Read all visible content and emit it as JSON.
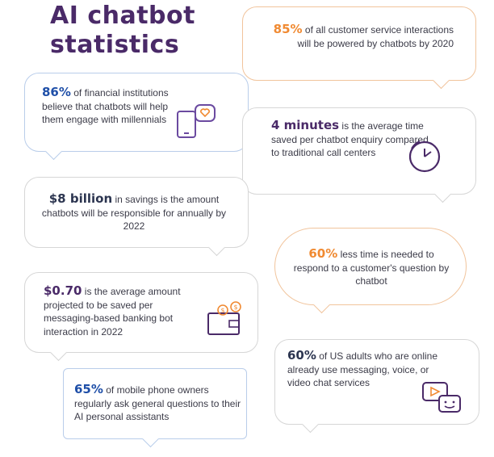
{
  "title": "AI chatbot statistics",
  "colors": {
    "title": "#4a2a68",
    "orange": "#f08a32",
    "blue": "#1f4fa8",
    "purple": "#4a2a68",
    "dark": "#2c3550"
  },
  "stats": [
    {
      "highlight": "85%",
      "text": "of all customer service interactions will be powered by chatbots by 2020"
    },
    {
      "highlight": "86%",
      "text": "of financial institutions believe that chatbots will help them engage with millennials",
      "icon": "phone-heart-icon"
    },
    {
      "highlight": "4 minutes",
      "text": "is the average time saved per chatbot enquiry compared to traditional call centers",
      "icon": "clock-icon"
    },
    {
      "highlight": "$8 billion",
      "text": "in savings is the amount chatbots will be responsible for annually by 2022"
    },
    {
      "highlight": "60%",
      "text": "less time is needed to respond to a customer's question by chatbot"
    },
    {
      "highlight": "$0.70",
      "text": "is the average amount projected to be saved per messaging-based banking bot interaction in 2022",
      "icon": "wallet-coins-icon"
    },
    {
      "highlight": "60%",
      "text": "of US adults who are online already use messaging, voice, or video chat services",
      "icon": "video-chat-icon"
    },
    {
      "highlight": "65%",
      "text": "of mobile phone owners regularly ask general questions to their AI personal assistants"
    }
  ]
}
